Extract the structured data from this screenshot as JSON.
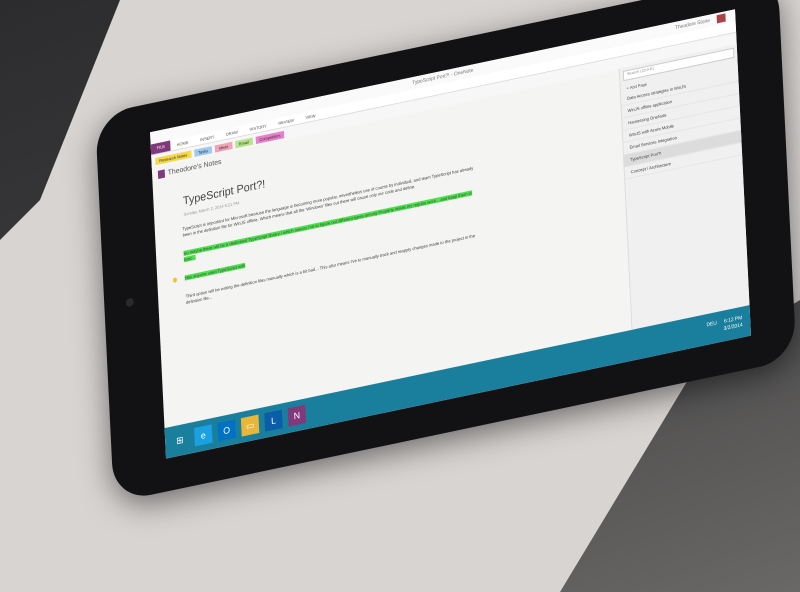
{
  "window": {
    "title": "TypeScript Port?! - OneNote",
    "user": "Theodore Stone"
  },
  "ribbon": {
    "file": "FILE",
    "tabs": [
      "HOME",
      "INSERT",
      "DRAW",
      "HISTORY",
      "REVIEW",
      "VIEW"
    ]
  },
  "tags": [
    {
      "label": "Research Notes",
      "color": "#f5d94a"
    },
    {
      "label": "Tasks",
      "color": "#9ec9f0"
    },
    {
      "label": "Ideas",
      "color": "#f0a3b8"
    },
    {
      "label": "Email",
      "color": "#b7e58c"
    },
    {
      "label": "Competitors",
      "color": "#e77fc9"
    }
  ],
  "notebook": {
    "title": "Theodore's Notes"
  },
  "page": {
    "title": "TypeScript Port?!",
    "date": "Sunday, March 2, 2014   6:21 PM",
    "paragraphs": [
      "TypeScript is important for Microsoft because the language is becoming more popular, nevertheless use of course by individual, and team TypeScript has already been in the definition file for WinJS offline. Which means that all the 'Windows' files out there will cause only our code and define.",
      "So maybe there will be a dedicated TypeScript library / which means I've to figure out different types among Property inside my regular work... and keep them in sync...",
      "Has anyone used TypeScript with",
      "Third option will be writing the definition files manually which is a bit bad... This also means I've to manually track and reapply changes made to the project in the definition file..."
    ]
  },
  "sidebar": {
    "search_placeholder": "Search (Ctrl+E)",
    "add_page": "+ Add Page",
    "pages": [
      "Data Access strategies in WinJS",
      "WinJS offline application",
      "Harnessing OneNote",
      "WinJS with Azure Mobile",
      "Email Services Integration",
      "TypeScript Port?!",
      "Concept / Architecture"
    ]
  },
  "taskbar": {
    "apps": [
      "windows-start",
      "internet-explorer",
      "outlook",
      "file-explorer",
      "lync",
      "onenote"
    ],
    "language": "DEU",
    "time": "6:12 PM",
    "date": "3/2/2014"
  }
}
